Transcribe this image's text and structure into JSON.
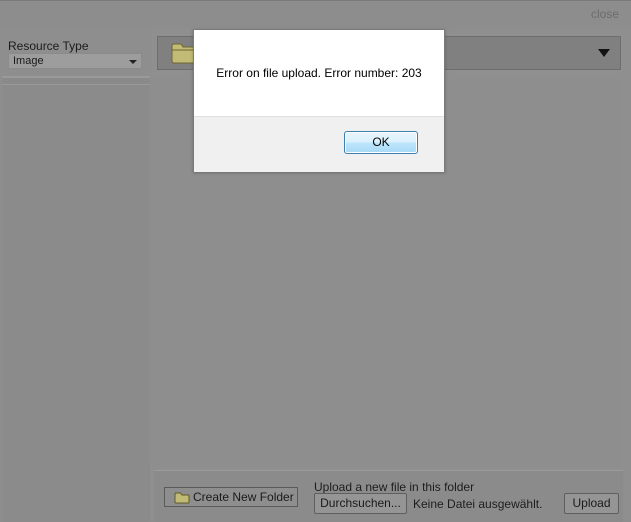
{
  "header": {
    "close_label": "close"
  },
  "sidebar": {
    "resource_type_label": "Resource Type",
    "resource_type_value": "Image"
  },
  "bottom": {
    "new_folder_label": "Create New Folder",
    "upload_caption": "Upload a new file in this folder",
    "browse_label": "Durchsuchen...",
    "file_status": "Keine Datei ausgewählt.",
    "upload_label": "Upload"
  },
  "dialog": {
    "message": "Error on file upload. Error number: 203",
    "ok_label": "OK"
  },
  "colors": {
    "folder_fill": "#c9c27a",
    "folder_stroke": "#7d7436",
    "dialog_button_border": "#3c7fb1"
  },
  "icons": {
    "folder": "folder-icon",
    "dropdown": "chevron-down-icon"
  }
}
